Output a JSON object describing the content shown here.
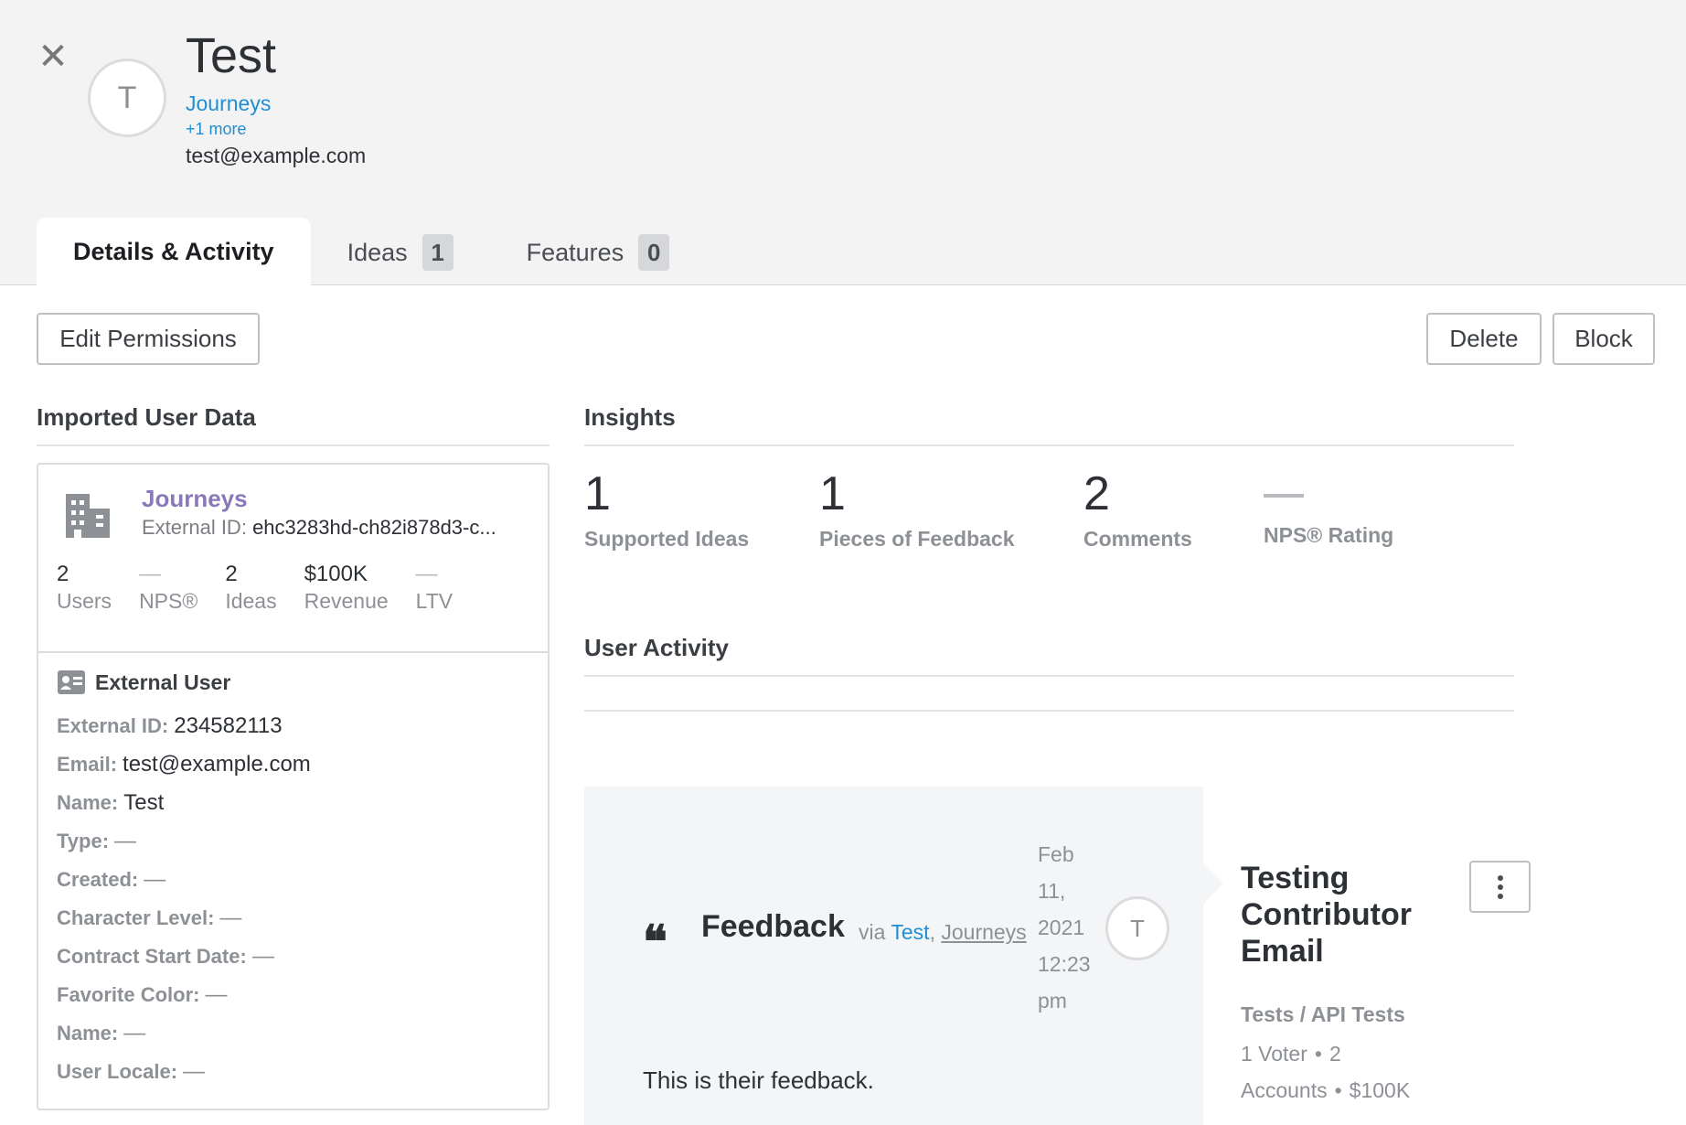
{
  "header": {
    "avatar_initial": "T",
    "name": "Test",
    "company": "Journeys",
    "more": "+1 more",
    "email": "test@example.com"
  },
  "tabs": [
    {
      "label": "Details & Activity",
      "count": null
    },
    {
      "label": "Ideas",
      "count": "1"
    },
    {
      "label": "Features",
      "count": "0"
    }
  ],
  "toolbar": {
    "edit_permissions": "Edit Permissions",
    "delete": "Delete",
    "block": "Block"
  },
  "imported_user_data": {
    "title": "Imported User Data",
    "org": {
      "name": "Journeys",
      "external_id_label": "External ID:",
      "external_id": "ehc3283hd-ch82i878d3-c...",
      "stats": [
        {
          "value": "2",
          "label": "Users"
        },
        {
          "value": "—",
          "label": "NPS®"
        },
        {
          "value": "2",
          "label": "Ideas"
        },
        {
          "value": "$100K",
          "label": "Revenue"
        },
        {
          "value": "—",
          "label": "LTV"
        }
      ]
    },
    "external_user": {
      "title": "External User",
      "fields": [
        {
          "label": "External ID:",
          "value": "234582113"
        },
        {
          "label": "Email:",
          "value": "test@example.com"
        },
        {
          "label": "Name:",
          "value": "Test"
        },
        {
          "label": "Type:",
          "value": "—"
        },
        {
          "label": "Created:",
          "value": "—"
        },
        {
          "label": "Character Level:",
          "value": "—"
        },
        {
          "label": "Contract Start Date:",
          "value": "—"
        },
        {
          "label": "Favorite Color:",
          "value": "—"
        },
        {
          "label": "Name:",
          "value": "—"
        },
        {
          "label": "User Locale:",
          "value": "—"
        }
      ]
    }
  },
  "insights": {
    "title": "Insights",
    "items": [
      {
        "value": "1",
        "label": "Supported Ideas"
      },
      {
        "value": "1",
        "label": "Pieces of Feedback"
      },
      {
        "value": "2",
        "label": "Comments"
      },
      {
        "value": "",
        "label": "NPS® Rating"
      }
    ]
  },
  "user_activity": {
    "title": "User Activity",
    "feedback": {
      "title": "Feedback",
      "via": "via",
      "via_user": "Test",
      "via_sep": ",",
      "via_company": "Journeys",
      "date_lines": [
        "Feb",
        "11,",
        "2021",
        "12:23",
        "pm"
      ],
      "avatar_initial": "T",
      "body": "This is their feedback."
    },
    "idea": {
      "title": "Testing Contributor Email",
      "category": "Tests / API Tests",
      "voters": "1 Voter",
      "accounts": "2 Accounts",
      "value": "$100K",
      "dot": "•"
    }
  }
}
